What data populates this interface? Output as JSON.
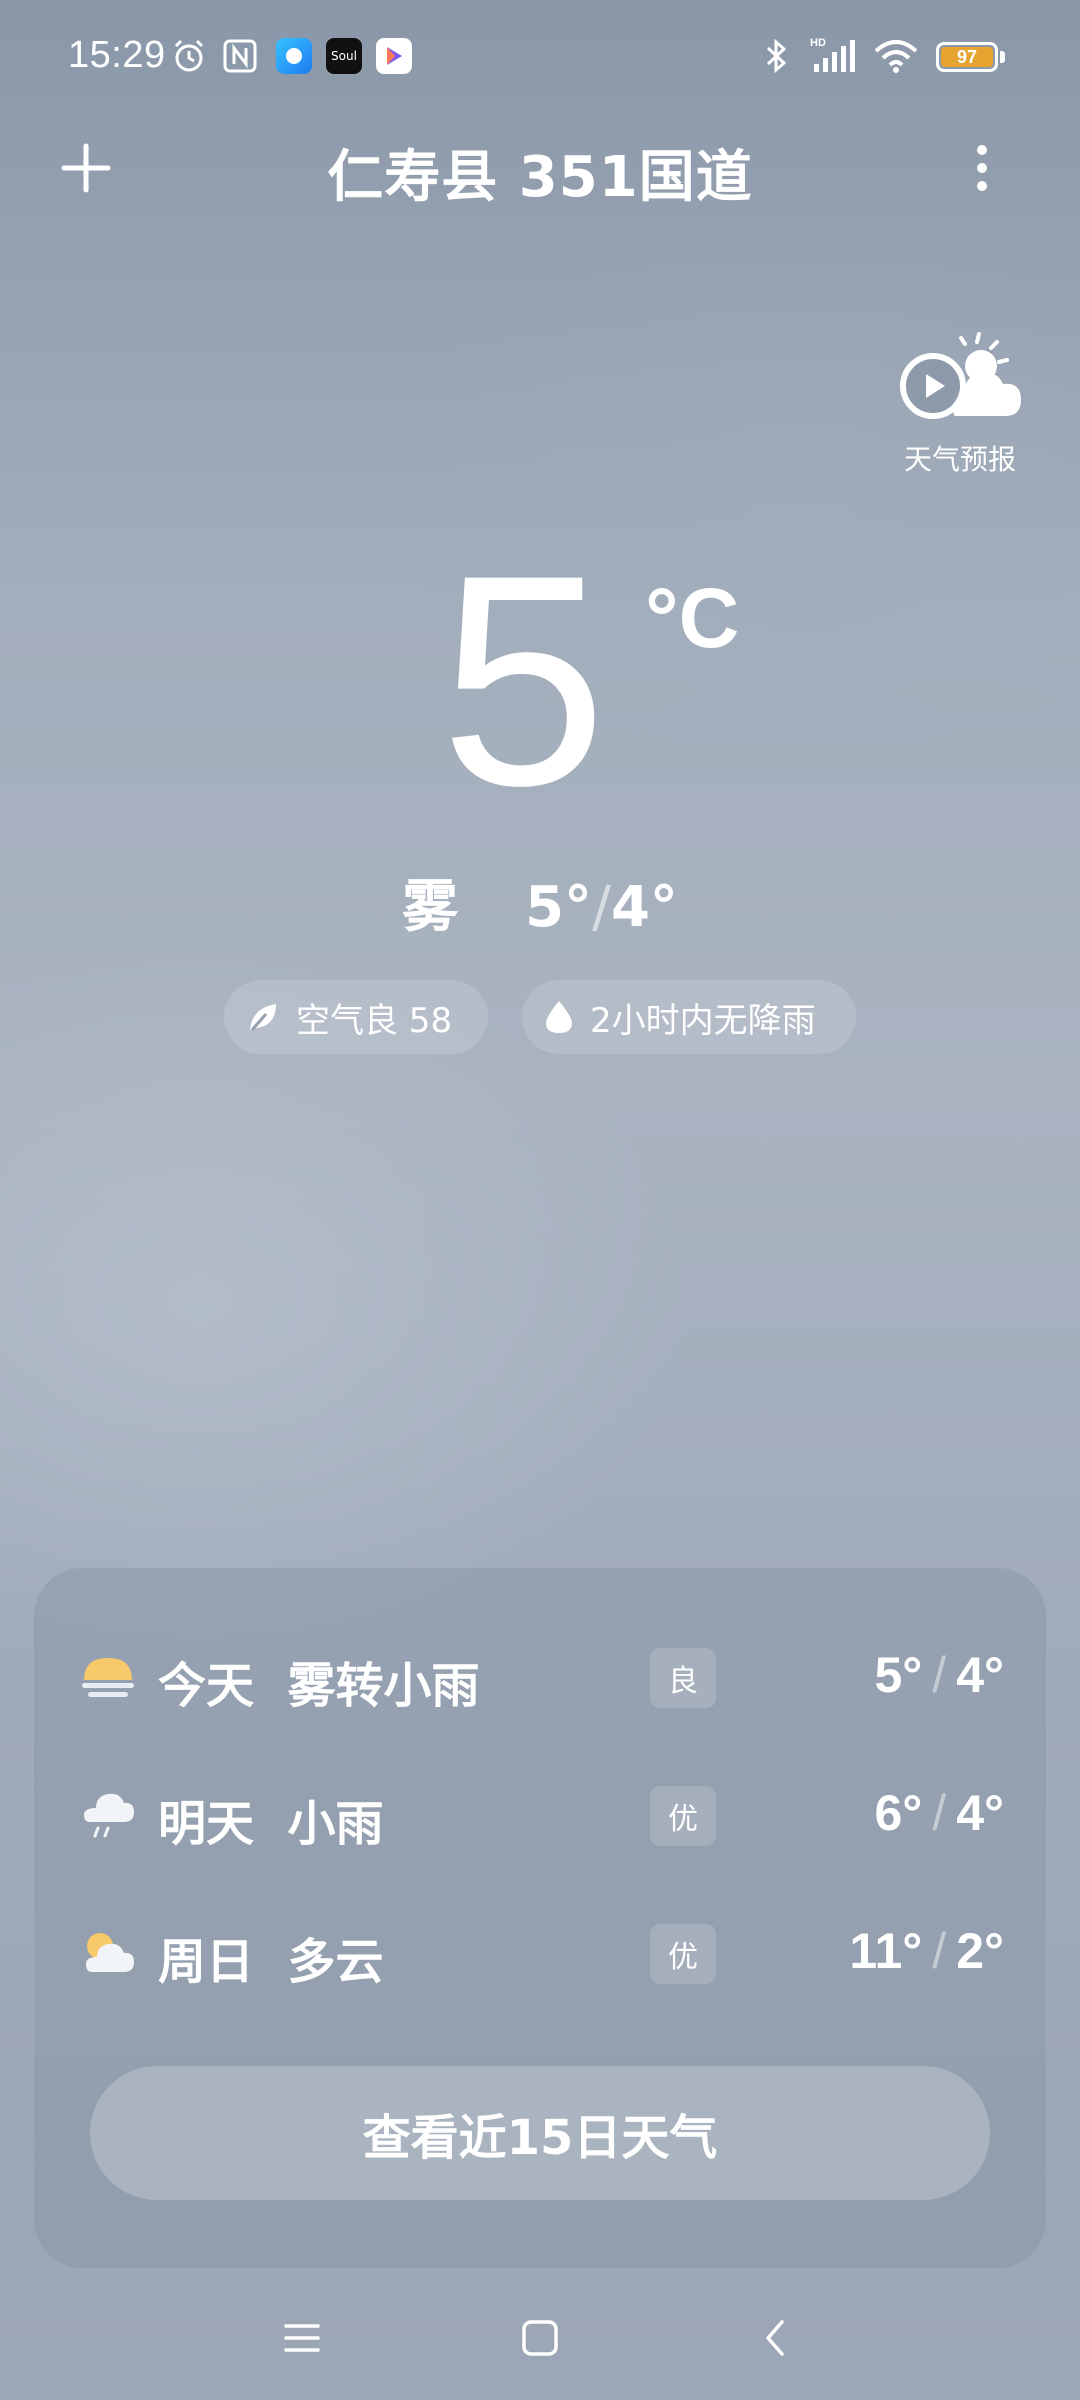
{
  "status_bar": {
    "time": "15:29",
    "app_icons": [
      "alarm-icon",
      "nfc-icon",
      "app-blue-icon",
      "soul-app-icon",
      "play-store-icon"
    ],
    "soul_label": "Soul",
    "hd_label": "HD",
    "battery_level": "97",
    "battery_color": "#e7a431"
  },
  "header": {
    "title": "仁寿县 351国道"
  },
  "forecast_video": {
    "label": "天气预报"
  },
  "current": {
    "temperature": "5",
    "unit": "°C",
    "condition": "雾",
    "high": "5°",
    "separator": "/",
    "low": "4°"
  },
  "pills": {
    "air": "空气良 58",
    "rain": "2小时内无降雨"
  },
  "daily": [
    {
      "day": "今天",
      "condition": "雾转小雨",
      "aqi": "良",
      "high": "5°",
      "low": "4°",
      "icon": "fog-icon"
    },
    {
      "day": "明天",
      "condition": "小雨",
      "aqi": "优",
      "high": "6°",
      "low": "4°",
      "icon": "light-rain-icon"
    },
    {
      "day": "周日",
      "condition": "多云",
      "aqi": "优",
      "high": "11°",
      "low": "2°",
      "icon": "partly-cloudy-icon"
    }
  ],
  "daily_separator": "/",
  "cta": {
    "label": "查看近15日天气"
  }
}
